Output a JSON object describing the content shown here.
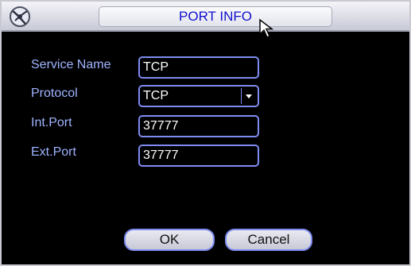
{
  "title": "PORT INFO",
  "form": {
    "service_name": {
      "label": "Service Name",
      "value": "TCP"
    },
    "protocol": {
      "label": "Protocol",
      "value": "TCP"
    },
    "int_port": {
      "label": "Int.Port",
      "value": "37777"
    },
    "ext_port": {
      "label": "Ext.Port",
      "value": "37777"
    }
  },
  "buttons": {
    "ok": "OK",
    "cancel": "Cancel"
  },
  "colors": {
    "accent": "#7e8cf0",
    "label": "#9fb4ff",
    "title": "#1111cc",
    "background": "#000000"
  },
  "icons": {
    "logo": "app-logo-icon",
    "cursor": "mouse-cursor-icon",
    "dropdown": "chevron-down-icon"
  }
}
